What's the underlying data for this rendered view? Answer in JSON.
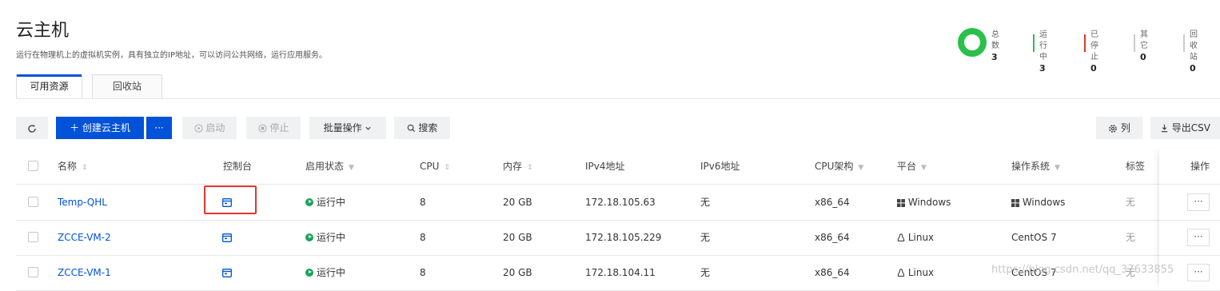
{
  "page": {
    "title": "云主机",
    "subtitle": "运行在物理机上的虚拟机实例，具有独立的IP地址，可以访问公共网络，运行应用服务。"
  },
  "stats": [
    {
      "label": "总数",
      "value": "3",
      "color": "#2ac04a"
    },
    {
      "label": "运行中",
      "value": "3",
      "color": "#2ac04a"
    },
    {
      "label": "已停止",
      "value": "0",
      "color": "#e5352c"
    },
    {
      "label": "其它",
      "value": "0",
      "color": "#cccccc"
    },
    {
      "label": "回收站",
      "value": "0",
      "color": "#cccccc"
    }
  ],
  "tabs": {
    "available": "可用资源",
    "recycle": "回收站"
  },
  "toolbar": {
    "refresh_icon": "refresh-icon",
    "create_label": "＋ 创建云主机",
    "more_label": "···",
    "start_label": "启动",
    "stop_label": "停止",
    "batch_label": "批量操作",
    "search_label": "搜索",
    "columns_label": "列",
    "export_label": "导出CSV"
  },
  "table": {
    "headers": {
      "name": "名称",
      "console": "控制台",
      "status": "启用状态",
      "cpu": "CPU",
      "memory": "内存",
      "ipv4": "IPv4地址",
      "ipv6": "IPv6地址",
      "arch": "CPU架构",
      "platform": "平台",
      "os": "操作系统",
      "tags": "标签",
      "actions": "操作"
    },
    "rows": [
      {
        "name": "Temp-QHL",
        "status": "运行中",
        "cpu": "8",
        "memory": "20 GB",
        "ipv4": "172.18.105.63",
        "ipv6": "无",
        "arch": "x86_64",
        "platform": "Windows",
        "os": "Windows",
        "tags": "无",
        "action": "···"
      },
      {
        "name": "ZCCE-VM-2",
        "status": "运行中",
        "cpu": "8",
        "memory": "20 GB",
        "ipv4": "172.18.105.229",
        "ipv6": "无",
        "arch": "x86_64",
        "platform": "Linux",
        "os": "CentOS 7",
        "tags": "无",
        "action": "···"
      },
      {
        "name": "ZCCE-VM-1",
        "status": "运行中",
        "cpu": "8",
        "memory": "20 GB",
        "ipv4": "172.18.104.11",
        "ipv6": "无",
        "arch": "x86_64",
        "platform": "Linux",
        "os": "CentOS 7",
        "tags": "无",
        "action": "···"
      }
    ]
  },
  "watermark": "https://blog.csdn.net/qq_37633855"
}
